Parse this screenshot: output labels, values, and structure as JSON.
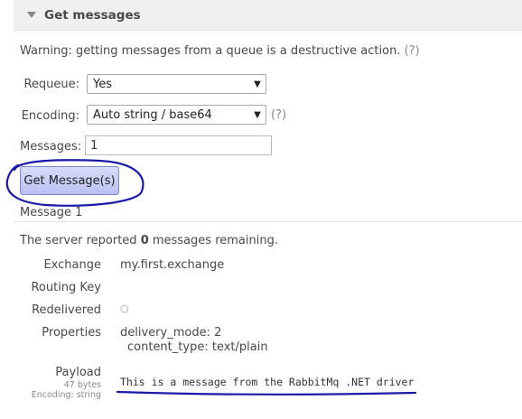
{
  "section": {
    "title": "Get messages"
  },
  "warning": {
    "text": "Warning: getting messages from a queue is a destructive action.",
    "help": "(?)"
  },
  "form": {
    "requeue": {
      "label": "Requeue:",
      "value": "Yes"
    },
    "encoding": {
      "label": "Encoding:",
      "value": "Auto string / base64",
      "help": "(?)"
    },
    "messages": {
      "label": "Messages:",
      "value": "1"
    },
    "button_label": "Get Message(s)"
  },
  "message": {
    "heading": "Message 1",
    "remaining_prefix": "The server reported ",
    "remaining_count": "0",
    "remaining_suffix": " messages remaining.",
    "exchange": {
      "label": "Exchange",
      "value": "my.first.exchange"
    },
    "routing_key": {
      "label": "Routing Key",
      "value": ""
    },
    "redelivered": {
      "label": "Redelivered",
      "value": "○"
    },
    "properties": {
      "label": "Properties",
      "items": [
        {
          "key": "delivery_mode:",
          "value": "2"
        },
        {
          "key": "content_type:",
          "value": "text/plain"
        }
      ]
    },
    "payload": {
      "label": "Payload",
      "size": "47 bytes",
      "encoding": "Encoding: string",
      "value": "This is a message from the RabbitMq .NET driver"
    }
  },
  "colors": {
    "annotation": "#1a1aaa",
    "button_top": "#d8dcf8",
    "button_bottom": "#b9c1f2"
  }
}
